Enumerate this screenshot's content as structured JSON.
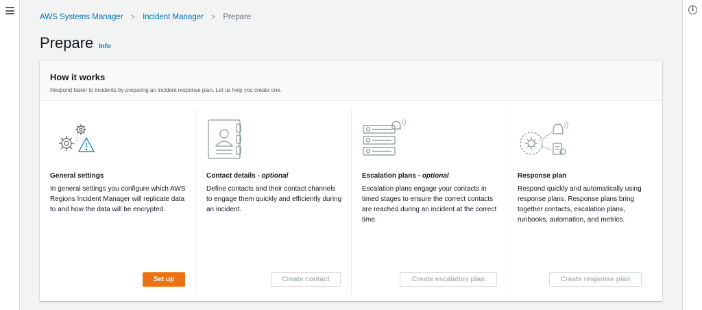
{
  "breadcrumb": {
    "items": [
      "AWS Systems Manager",
      "Incident Manager"
    ],
    "current": "Prepare",
    "separator": ">"
  },
  "page": {
    "title": "Prepare",
    "info_label": "Info"
  },
  "how_it_works": {
    "title": "How it works",
    "description": "Respond faster to incidents by preparing an incident response plan. Let us help you create one."
  },
  "columns": [
    {
      "title": "General settings",
      "optional": "",
      "description": "In general settings you configure which AWS Regions Incident Manager will replicate data to and how the data will be encrypted.",
      "button": "Set up",
      "icon": "gears-warning-icon"
    },
    {
      "title": "Contact details - ",
      "optional": "optional",
      "description": "Define contacts and their contact channels to engage them quickly and efficiently during an incident.",
      "button": "Create contact",
      "icon": "contact-card-icon"
    },
    {
      "title": "Escalation plans - ",
      "optional": "optional",
      "description": "Escalation plans engage your contacts in timed stages to ensure the correct contacts are reached during an incident at the correct time.",
      "button": "Create escalation plan",
      "icon": "escalation-list-icon"
    },
    {
      "title": "Response plan",
      "optional": "",
      "description": "Respond quickly and automatically using response plans. Response plans bring together contacts, escalation plans, runbooks, automation, and metrics.",
      "button": "Create response plan",
      "icon": "response-plan-icon"
    }
  ],
  "colors": {
    "link": "#0073bb",
    "primary_button": "#ec7211",
    "disabled_text": "#aab7b8",
    "illustration": "#879596",
    "warning": "#0073bb"
  }
}
